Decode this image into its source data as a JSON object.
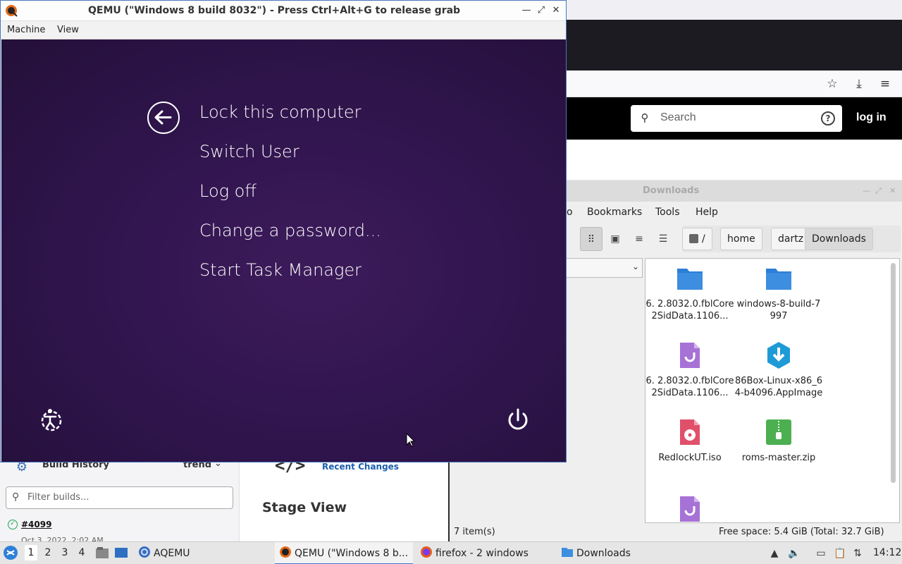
{
  "qemu": {
    "title": "QEMU (\"Windows 8 build 8032\") - Press Ctrl+Alt+G to release grab",
    "menu": [
      "Machine",
      "View"
    ],
    "guest": {
      "options": [
        "Lock this computer",
        "Switch User",
        "Log off",
        "Change a password...",
        "Start Task Manager"
      ],
      "back_icon": "back-arrow-icon",
      "ease_icon": "ease-of-access-icon",
      "power_icon": "power-icon"
    }
  },
  "firefox": {
    "search_placeholder": "Search",
    "login_label": "log in"
  },
  "jenkins": {
    "build_history_title": "Build History",
    "trend_label": "trend",
    "filter_placeholder": "Filter builds...",
    "build_number": "#4099",
    "build_date": "Oct 3, 2022, 2:02 AM",
    "recent_changes_icon_text": "</>",
    "recent_changes_label": "Recent Changes",
    "stage_view_title": "Stage View"
  },
  "file_manager": {
    "title": "Downloads",
    "menu": [
      "o",
      "Bookmarks",
      "Tools",
      "Help"
    ],
    "path": [
      "/",
      "home",
      "dartz",
      "Downloads"
    ],
    "files": [
      {
        "name": "6. 2.8032.0.fblCore 2SidData.1106...",
        "icon": "folder-icon"
      },
      {
        "name": "windows-8-build-7997",
        "icon": "folder-icon"
      },
      {
        "name": "6. 2.8032.0.fblCore 2SidData.1106...",
        "icon": "torrent-file-icon"
      },
      {
        "name": "86Box-Linux-x86_64-b4096.AppImage",
        "icon": "appimage-download-icon"
      },
      {
        "name": "RedlockUT.iso",
        "icon": "disc-image-icon"
      },
      {
        "name": "roms-master.zip",
        "icon": "zip-archive-icon"
      },
      {
        "name": "",
        "icon": "torrent-file-icon"
      }
    ],
    "status_items": "7 item(s)",
    "status_space": "Free space: 5.4 GiB (Total: 32.7 GiB)"
  },
  "taskbar": {
    "workspaces": [
      "1",
      "2",
      "3",
      "4"
    ],
    "tasks": [
      {
        "label": "AQEMU",
        "icon": "aqemu-icon"
      },
      {
        "label": "QEMU (\"Windows 8 b...",
        "icon": "qemu-icon"
      },
      {
        "label": "firefox - 2 windows",
        "icon": "firefox-icon"
      },
      {
        "label": "Downloads",
        "icon": "folder-icon"
      }
    ],
    "clock": "14:12"
  },
  "colors": {
    "win8_background": "#2e1549",
    "accent": "#3a77d4",
    "folder": "#3d8ee0"
  }
}
